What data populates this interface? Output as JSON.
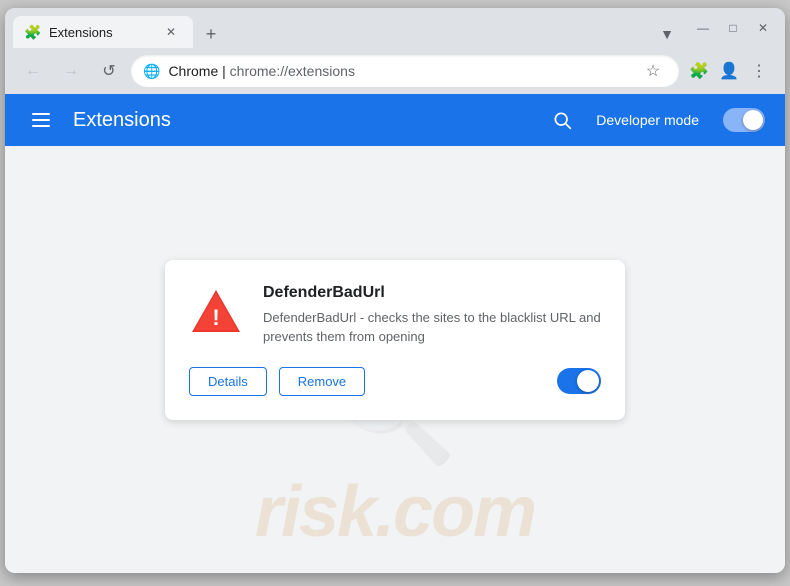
{
  "window": {
    "title": "Extensions",
    "tab_title": "Extensions",
    "controls": {
      "minimize": "—",
      "maximize": "□",
      "close": "✕"
    }
  },
  "address_bar": {
    "favicon_label": "Chrome",
    "domain": "Chrome",
    "separator": " | ",
    "path": "chrome://extensions",
    "full_url": "Chrome  |  chrome://extensions"
  },
  "toolbar": {
    "back_label": "←",
    "forward_label": "→",
    "reload_label": "↺",
    "bookmark_label": "☆",
    "extensions_label": "🧩",
    "profile_label": "👤",
    "menu_label": "⋮",
    "profile_arrow": "▼"
  },
  "extensions_page": {
    "title": "Extensions",
    "search_label": "🔍",
    "developer_mode_label": "Developer mode",
    "toggle_state": true
  },
  "extension": {
    "name": "DefenderBadUrl",
    "description": "DefenderBadUrl - checks the sites to the blacklist URL and prevents them from opening",
    "enabled": true,
    "details_label": "Details",
    "remove_label": "Remove"
  },
  "watermark": {
    "icon": "🔍",
    "text": "risk.com"
  }
}
